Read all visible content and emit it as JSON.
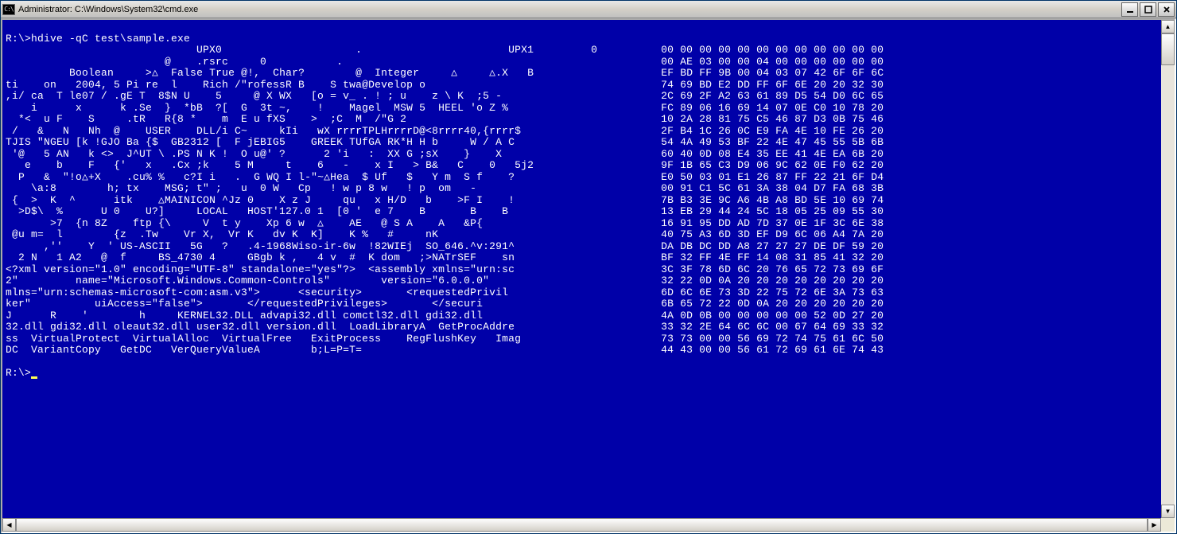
{
  "window": {
    "title": "Administrator: C:\\Windows\\System32\\cmd.exe"
  },
  "prompt": "R:\\>",
  "command": "hdive -qC test\\sample.exe",
  "prompt2": "R:\\>",
  "rows": [
    {
      "left": "                              UPX0                     .                       UPX1         0      ",
      "hex": "00 00 00 00 00 00 00 00 00 00 00 00"
    },
    {
      "left": "                         @    .rsrc     0           .                                              ",
      "hex": "00 AE 03 00 00 04 00 00 00 00 00 00"
    },
    {
      "left": "          Boolean     >△  False True @!,  Char?        @  Integer     △     △.X   B    ",
      "hex": "EF BD FF 9B 00 04 03 07 42 6F 6F 6C"
    },
    {
      "left": "ti    on   2004, 5 Pi re  l    Rich /\"rofessR B    S twa@Develop o                          ",
      "hex": "74 69 BD E2 DD FF 6F 6E 20 20 32 30"
    },
    {
      "left": ",i/ ca  T le07 / .gE T  8$N U    5     @ X WX   [o = v_ . ! ; u    z \\ K  ;5 -      ",
      "hex": "2C 69 2F A2 63 61 89 D5 54 D0 6C 65"
    },
    {
      "left": "    i      x      k .Se  }  *bB  ?[  G  3t ~,    !    Magel  MSW 5  HEEL 'o Z %     ",
      "hex": "FC 89 06 16 69 14 07 0E C0 10 78 20"
    },
    {
      "left": "  *<  u F    S     .tR   R{8 *    m  E u fXS    >  ;C  M  /\"G 2                    ",
      "hex": "10 2A 28 81 75 C5 46 87 D3 0B 75 46"
    },
    {
      "left": " /   &   N   Nh  @    USER    DLL/i C~     kIi   wX rrrrTPLHrrrrD@<8rrrr40,{rrrr$   ",
      "hex": "2F B4 1C 26 0C E9 FA 4E 10 FE 26 20"
    },
    {
      "left": "TJIS \"NGEU [k !GJO Ba {$  GB2312 [  F jEBIG5    GREEK TUfGA RK*H H b     W / A C    ",
      "hex": "54 4A 49 53 BF 22 4E 47 45 55 5B 6B"
    },
    {
      "left": " '@   5 AN   k <>  J^UT \\ .PS N K !  O u@' ?      2 'i   :  XX G ;sX    }    X     ",
      "hex": "60 40 0D 08 E4 35 EE 41 4E EA 6B 20"
    },
    {
      "left": "   e    b    F   {'   x   .Cx ;k    5 M     t    6   -    x I   > B&   C    0   5j2 ",
      "hex": "9F 1B 65 C3 D9 06 9C 62 0E F0 62 20"
    },
    {
      "left": "  P   &  \"!o△+X    .cu% %   c?I i   .  G WQ I l-\"~△Hea  $ Uf   $   Y m  S f    ?    ",
      "hex": "E0 50 03 01 E1 26 87 FF 22 21 6F D4"
    },
    {
      "left": "    \\a:8        h; tx    MSG; t\" ;   u  0 W   Cp   ! w p 8 w   ! p  om   -          ",
      "hex": "00 91 C1 5C 61 3A 38 04 D7 FA 68 3B"
    },
    {
      "left": " {  >  K  ^      itk    △MAINICON ^Jz 0    X z J     qu   x H/D   b    >F I    !    ",
      "hex": "7B B3 3E 9C A6 4B A8 BD 5E 10 69 74"
    },
    {
      "left": "  >D$\\  %      U 0    U?]     LOCAL   HOST'127.0 1  [0 '  e 7    B       B    B     ",
      "hex": "13 EB 29 44 24 5C 18 05 25 09 55 30"
    },
    {
      "left": "       >7  {n 8Z    ftp {\\     V  t y    Xp 6 w  △    AE   @ S A    A   &P{         ",
      "hex": "16 91 95 DD AD 7D 37 0E 1F 3C 6E 38"
    },
    {
      "left": " @u m=  l        {z  .Tw    Vr X,  Vr K   dv K  K]    K %   #     nK                ",
      "hex": "40 75 A3 6D 3D EF D9 6C 06 A4 7A 20"
    },
    {
      "left": "      ,''    Y  ' US-ASCII   5G   ?   .4-1968Wiso-ir-6w  !82WIEj  SO_646.^v:291^    ",
      "hex": "DA DB DC DD A8 27 27 27 DE DF 59 20"
    },
    {
      "left": "  2 N   1 A2   @  f     BS_4730 4     GBgb k ,   4 v  #  K dom   ;>NATrSEF    sn    ",
      "hex": "BF 32 FF 4E FF 14 08 31 85 41 32 20"
    },
    {
      "left": "<?xml version=\"1.0\" encoding=\"UTF-8\" standalone=\"yes\"?>  <assembly xmlns=\"urn:sc    ",
      "hex": "3C 3F 78 6D 6C 20 76 65 72 73 69 6F"
    },
    {
      "left": "2\"         name=\"Microsoft.Windows.Common-Controls\"        version=\"6.0.0.0\"        ",
      "hex": "32 22 0D 0A 20 20 20 20 20 20 20 20"
    },
    {
      "left": "mlns=\"urn:schemas-microsoft-com:asm.v3\">      <security>       <requestedPrivil     ",
      "hex": "6D 6C 6E 73 3D 22 75 72 6E 3A 73 63"
    },
    {
      "left": "ker\"          uiAccess=\"false\">       </requestedPrivileges>       </securi         ",
      "hex": "6B 65 72 22 0D 0A 20 20 20 20 20 20"
    },
    {
      "left": "J      R    '        h     KERNEL32.DLL advapi32.dll comctl32.dll gdi32.dll         ",
      "hex": "4A 0D 0B 00 00 00 00 00 52 0D 27 20"
    },
    {
      "left": "32.dll gdi32.dll oleaut32.dll user32.dll version.dll  LoadLibraryA  GetProcAddre    ",
      "hex": "33 32 2E 64 6C 6C 00 67 64 69 33 32"
    },
    {
      "left": "ss  VirtualProtect  VirtualAlloc  VirtualFree   ExitProcess    RegFlushKey   Imag   ",
      "hex": "73 73 00 00 56 69 72 74 75 61 6C 50"
    },
    {
      "left": "DC  VariantCopy   GetDC   VerQueryValueA        b;L=P=T=                            ",
      "hex": "44 43 00 00 56 61 72 69 61 6E 74 43"
    }
  ]
}
